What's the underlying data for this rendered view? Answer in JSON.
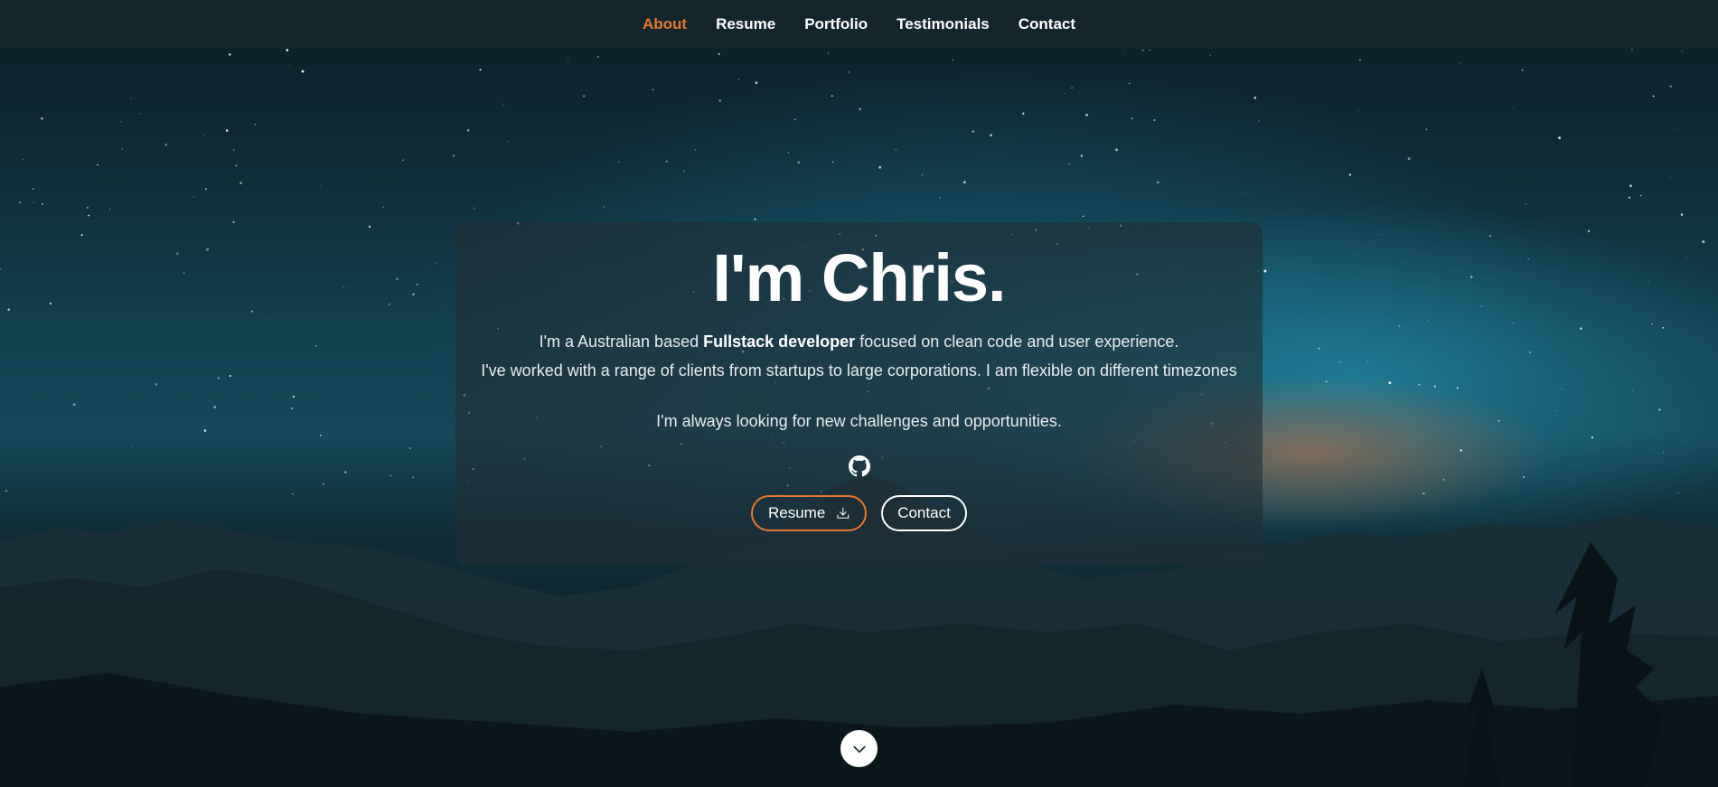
{
  "nav": {
    "items": [
      {
        "label": "About",
        "active": true
      },
      {
        "label": "Resume",
        "active": false
      },
      {
        "label": "Portfolio",
        "active": false
      },
      {
        "label": "Testimonials",
        "active": false
      },
      {
        "label": "Contact",
        "active": false
      }
    ]
  },
  "hero": {
    "title": "I'm Chris.",
    "line1_before": "I'm a Australian based ",
    "line1_strong": "Fullstack developer",
    "line1_after": " focused on clean code and user experience.",
    "line2": "I've worked with a range of clients from startups to large corporations. I am flexible on different timezones",
    "line3": "I'm always looking for new challenges and opportunities.",
    "social_icon": "github-icon",
    "buttons": {
      "resume_label": "Resume",
      "resume_icon": "download-icon",
      "contact_label": "Contact"
    }
  },
  "scroll": {
    "icon": "chevron-down-icon"
  },
  "colors": {
    "accent": "#e8772e",
    "navbar_bg": "#14252c",
    "text": "#ffffff"
  }
}
